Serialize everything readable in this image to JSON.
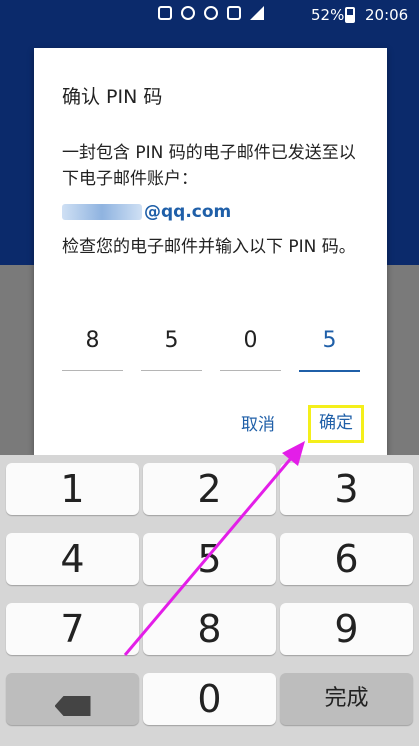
{
  "status_bar": {
    "battery_percent": "52%",
    "time": "20:06",
    "icons": [
      "nfc-icon",
      "alarm-icon",
      "wifi-icon",
      "sim-icon",
      "signal-icon",
      "battery-icon"
    ]
  },
  "dialog": {
    "title": "确认 PIN 码",
    "message": "一封包含 PIN 码的电子邮件已发送至以下电子邮件账户：",
    "email_visible": "@qq.com",
    "instruction": "检查您的电子邮件并输入以下 PIN 码。",
    "pin_digits": [
      "8",
      "5",
      "0",
      "5"
    ],
    "cancel_label": "取消",
    "ok_label": "确定"
  },
  "keyboard": {
    "row1": [
      "1",
      "2",
      "3"
    ],
    "row2": [
      "4",
      "5",
      "6"
    ],
    "row3": [
      "7",
      "8",
      "9"
    ],
    "row4_middle": "0",
    "done_label": "完成"
  },
  "colors": {
    "accent": "#1f5fa8",
    "highlight": "#f4ef1a",
    "arrow": "#e31ee8"
  }
}
